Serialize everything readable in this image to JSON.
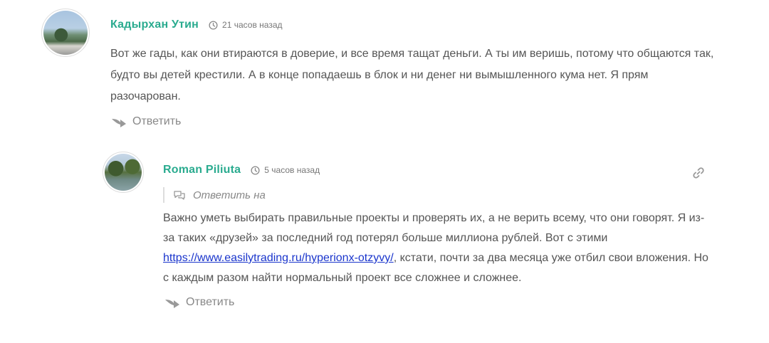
{
  "comments": [
    {
      "author": "Кадырхан Утин",
      "time": "21 часов назад",
      "text": "Вот же гады, как они втираются в доверие, и все время тащат деньги. А ты им веришь, потому что общаются так, будто вы детей крестили. А в конце попадаешь в блок и ни денег ни вымышленного кума нет. Я прям разочарован.",
      "reply_label": "Ответить",
      "icons": {
        "avatar": "avatar-photo",
        "time": "clock-icon",
        "reply": "reply-arrow-icon"
      }
    },
    {
      "author": "Roman Piliuta",
      "time": "5 часов назад",
      "reply_to_label": "Ответить на",
      "text_before_link": "Важно уметь выбирать правильные проекты и проверять их, а не верить всему, что они говорят. Я из-за таких «друзей» за последний год потерял больше миллиона рублей. Вот с этими ",
      "link_text": "https://www.easilytrading.ru/hyperionx-otzyvy/",
      "text_after_link": ", кстати, почти за два месяца уже отбил свои вложения. Но с каждым разом найти нормальный проект все сложнее и сложнее.",
      "reply_label": "Ответить",
      "icons": {
        "avatar": "avatar-photo",
        "time": "clock-icon",
        "reply_to": "chat-bubble-icon",
        "permalink": "link-icon",
        "reply": "reply-arrow-icon"
      }
    }
  ],
  "colors": {
    "author": "#2aab8f",
    "text": "#555555",
    "muted": "#888888",
    "link": "#1a35cc"
  }
}
